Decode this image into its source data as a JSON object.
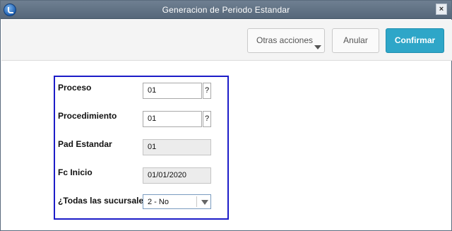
{
  "window": {
    "title": "Generacion de Periodo Estandar"
  },
  "toolbar": {
    "otras_label": "Otras acciones",
    "anular_label": "Anular",
    "confirmar_label": "Confirmar"
  },
  "form": {
    "proceso": {
      "label": "Proceso",
      "value": "01",
      "lookup": "?"
    },
    "procedimiento": {
      "label": "Procedimiento",
      "value": "01",
      "lookup": "?"
    },
    "pad_estandar": {
      "label": "Pad Estandar",
      "value": "01"
    },
    "fc_inicio": {
      "label": "Fc Inicio",
      "value": "01/01/2020"
    },
    "todas_sucursales": {
      "label": "¿Todas las sucursales",
      "value": "2 - No"
    }
  },
  "colors": {
    "accent": "#2ea6c8",
    "highlight_border": "#1c1cc8",
    "titlebar": "#5f7084"
  }
}
